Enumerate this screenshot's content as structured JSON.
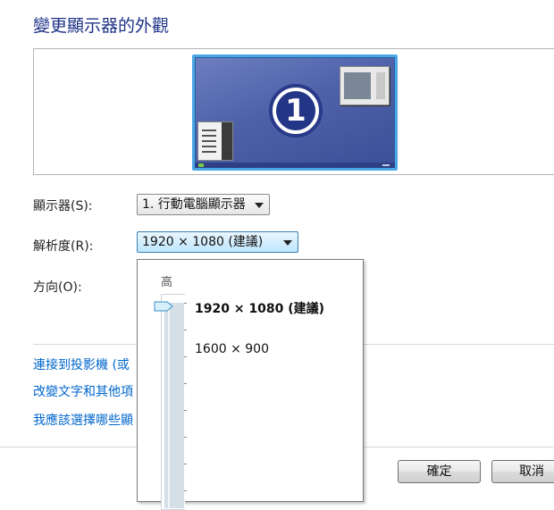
{
  "title": "變更顯示器的外觀",
  "preview": {
    "monitor_number": "1"
  },
  "display": {
    "label": "顯示器(S):",
    "value": "1. 行動電腦顯示器"
  },
  "resolution": {
    "label": "解析度(R):",
    "value": "1920 × 1080 (建議)",
    "dropdown": {
      "high_label": "高",
      "options": [
        "1920 × 1080 (建議)",
        "1600 × 900"
      ],
      "selected_index": 0
    }
  },
  "orientation": {
    "label": "方向(O):"
  },
  "links": {
    "projector": "連接到投影機 (或",
    "text_size": "改變文字和其他項",
    "which_settings": "我應該選擇哪些顯"
  },
  "buttons": {
    "ok": "確定",
    "cancel": "取消"
  },
  "colors": {
    "title": "#1e3287",
    "link": "#0066cc",
    "monitor_border": "#4aa7e6"
  }
}
